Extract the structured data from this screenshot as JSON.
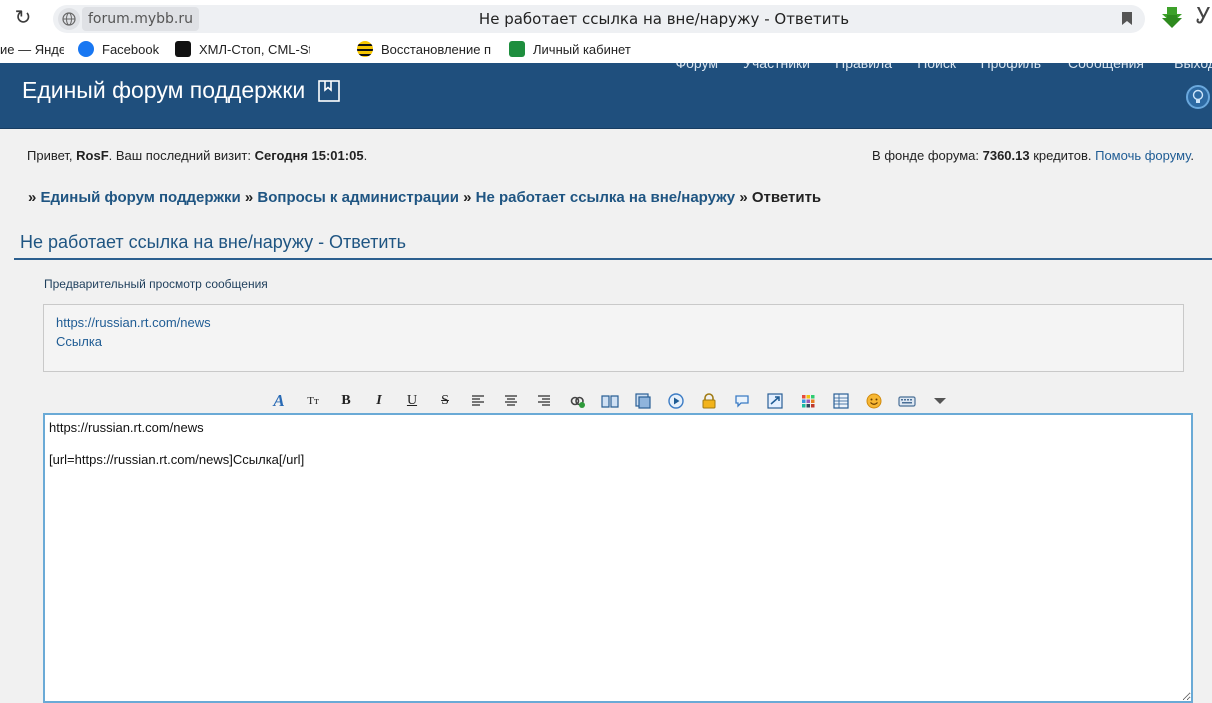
{
  "browser": {
    "url": "forum.mybb.ru",
    "tab_title": "Не работает ссылка на вне/наружу - Ответить"
  },
  "bookmarks": [
    {
      "label": "ие — Янде",
      "icon": "yandex-icon"
    },
    {
      "label": "Facebook",
      "icon": "facebook-icon"
    },
    {
      "label": "ХМЛ-Стоп, CML-St",
      "icon": "xml-icon"
    },
    {
      "label": "Восстановление п",
      "icon": "beeline-icon"
    },
    {
      "label": "Личный кабинет",
      "icon": "cabinet-icon"
    }
  ],
  "header": {
    "title": "Единый форум поддержки",
    "nav": [
      "Форум",
      "Участники",
      "Правила",
      "Поиск",
      "Профиль",
      "Сообщения",
      "Выход"
    ]
  },
  "welcome": {
    "greeting": "Привет, ",
    "username": "RosF",
    "last_visit_label": ".  Ваш последний визит: ",
    "last_visit_value": "Сегодня 15:01:05",
    "dot": ".",
    "fund_label": "В фонде форума: ",
    "fund_value": "7360.13",
    "fund_suffix": " кредитов. ",
    "help_link": "Помочь форуму",
    "end_dot": "."
  },
  "breadcrumb": {
    "sep": "»",
    "items": [
      "Единый форум поддержки",
      "Вопросы к администрации",
      "Не работает ссылка на вне/наружу"
    ],
    "current": "Ответить"
  },
  "page": {
    "title": "Не работает ссылка на вне/наружу - Ответить",
    "preview_label": "Предварительный просмотр сообщения",
    "preview_lines": [
      "https://russian.rt.com/news",
      "Ссылка"
    ]
  },
  "editor": {
    "content": "https://russian.rt.com/news\n\n[url=https://russian.rt.com/news]Ссылка[/url]"
  },
  "toolbar": [
    "font-icon",
    "size-icon",
    "bold-icon",
    "italic-icon",
    "underline-icon",
    "strike-icon",
    "align-left-icon",
    "align-center-icon",
    "align-right-icon",
    "link-icon",
    "quote-icon",
    "image-icon",
    "video-icon",
    "hide-icon",
    "spoiler-icon",
    "code-icon",
    "color-icon",
    "table-icon",
    "smile-icon",
    "keyboard-icon",
    "more-icon"
  ],
  "colors": {
    "header_bg": "#1f4f7d",
    "link": "#1f5582",
    "accent": "#6aaad6"
  }
}
